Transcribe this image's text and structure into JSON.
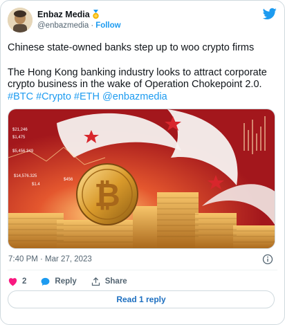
{
  "author": {
    "name": "Enbaz Media",
    "handle": "@enbazmedia",
    "separator": "·",
    "follow_label": "Follow"
  },
  "tweet": {
    "line1": "Chinese state-owned banks step up to woo crypto firms",
    "line2": "The Hong Kong banking industry looks to attract corporate crypto business in the wake of Operation Chokepoint 2.0. ",
    "hashtags": [
      "#BTC",
      "#Crypto",
      "#ETH",
      "@enbazmedia"
    ]
  },
  "media_overlay": {
    "prices": [
      "$21,246",
      "$1,475",
      "$5,456.349",
      "$14,576.325",
      "$1.4",
      "$456"
    ]
  },
  "meta": {
    "timestamp": "7:40 PM · Mar 27, 2023"
  },
  "actions": {
    "like_count": "2",
    "reply_label": "Reply",
    "share_label": "Share"
  },
  "read_replies_label": "Read 1 reply",
  "colors": {
    "accent": "#1d9bf0",
    "like": "#f91880",
    "text_secondary": "#536471",
    "flag_red": "#d8262c"
  }
}
